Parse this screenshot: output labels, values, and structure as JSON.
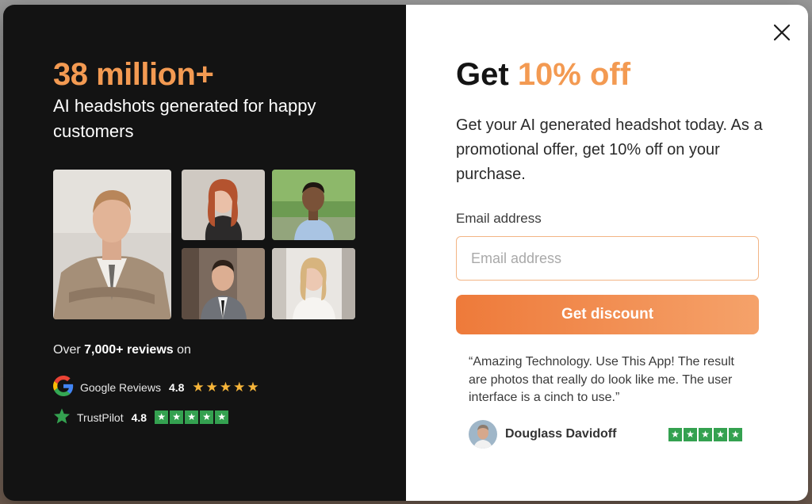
{
  "left": {
    "stat_big": "38 million+",
    "stat_sub": "AI headshots generated for happy customers",
    "reviews_prefix": "Over",
    "reviews_count": "7,000+ reviews",
    "reviews_suffix": "on",
    "google": {
      "label": "Google Reviews",
      "score": "4.8",
      "stars": "★★★★★"
    },
    "trustpilot": {
      "label": "TrustPilot",
      "score": "4.8",
      "star_glyph": "★"
    }
  },
  "right": {
    "title_prefix": "Get",
    "title_accent": "10% off",
    "description": "Get your AI generated headshot today. As a promotional offer, get 10% off on your purchase.",
    "email_label": "Email address",
    "email_placeholder": "Email address",
    "email_value": "",
    "cta_label": "Get discount",
    "quote": "“Amazing Technology. Use This App! The result are photos that really do look like me. The user interface is a cinch to use.”",
    "author_name": "Douglass Davidoff",
    "author_star_glyph": "★"
  },
  "colors": {
    "accent": "#f39a52",
    "dark_panel": "#131313",
    "cta_start": "#ee7a3a",
    "cta_end": "#f5a26a",
    "trustpilot_green": "#34a150",
    "star_gold": "#f6b53a"
  },
  "icons": {
    "close": "close-icon",
    "google": "google-logo-icon",
    "trustpilot": "trustpilot-star-icon"
  }
}
